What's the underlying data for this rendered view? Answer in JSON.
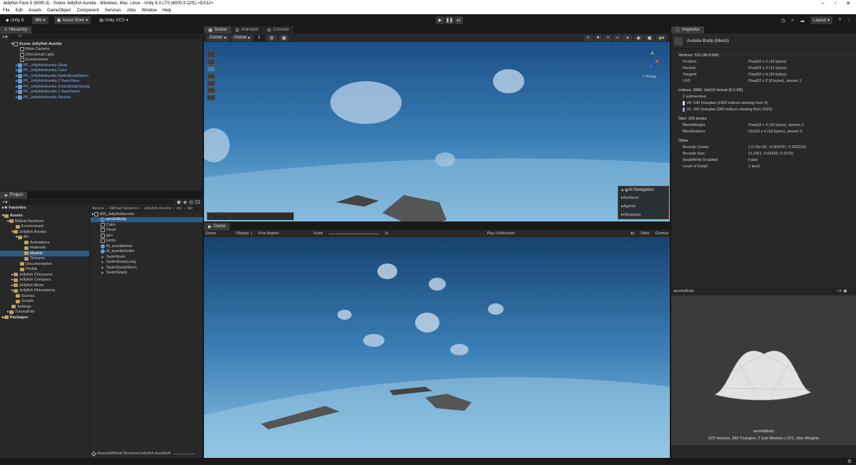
{
  "window": {
    "title": "Jellyfish Pack 5 (6000.3) - Scene Jellyfish Aurelia - Windows, Mac, Linux - Unity 6.3 LTS (6000.3.22f1) <DX12>"
  },
  "menu": [
    "File",
    "Edit",
    "Assets",
    "GameObject",
    "Component",
    "Services",
    "Jobs",
    "Window",
    "Help"
  ],
  "toolbar": {
    "unity": "Unity 6",
    "account": "MN",
    "store": "Asset Store",
    "vcs": "Unity VCS",
    "layout": "Layout"
  },
  "hierarchy": {
    "tab": "Hierarchy",
    "search_placeholder": "All",
    "scene": "Scene Jellyfish Aurelia",
    "items": [
      "Main Camera",
      "Directional Light",
      "Environment"
    ],
    "prefabs": [
      "PF_JellyfishAurelia Dead",
      "PF_JellyfishAurelia Calm",
      "PF_JellyfishAurelia SwimSlowlyNorm",
      "PF_JellyfishAurelia 2 SwimSlow",
      "PF_JellyfishAurelia SwimSlowlySlowly",
      "PF_JellyfishAurelia 1 SwimNorm",
      "PF_JellyfishAurelia Stracks"
    ]
  },
  "project": {
    "tab": "Project",
    "count": "21",
    "favorites": "Favorites",
    "assets": "Assets",
    "packages": "Packages",
    "tree": [
      "Mikhail Nesterov",
      "Environment",
      "Jellyfish Aurelia",
      "Art",
      "Animations",
      "Materials",
      "Models",
      "Textures",
      "Documentation",
      "Prefab",
      "Jellyfish Chrysaora",
      "Jellyfish Compass",
      "Jellyfish Moon",
      "Jellyfish Rhizostoma",
      "Scenes",
      "Scripts",
      "Settings",
      "TutorialInfo"
    ],
    "breadcrumb": [
      "Assets",
      "Mikhail Nesterov",
      "Jellyfish Aurelia",
      "Art",
      "Mo"
    ],
    "files": [
      "AM_JellyfishAurelia",
      "aureliaBody",
      "Calm",
      "Dead",
      "geo",
      "joints",
      "M_aureliaInner",
      "M_aureliaOutter",
      "SwimNorm",
      "SwimSlowlyLong",
      "SwimSlowlyNorm",
      "SwimSlowly"
    ],
    "footer": "Assets/Mikhail Nesterov/Jellyfish Aurelia/A"
  },
  "scene": {
    "tabs": [
      "Scene",
      "Animator",
      "Console"
    ],
    "pivot": "Center",
    "space": "Global",
    "snap": "1",
    "persp": "< Persp",
    "ai_nav": {
      "title": "AI Navigation",
      "items": [
        "Surfaces",
        "Agents",
        "Obstacles"
      ]
    }
  },
  "game": {
    "tab": "Game",
    "mode": "Game",
    "display": "Display 1",
    "aspect": "Free Aspect",
    "scale_label": "Scale",
    "scale_value": "1x",
    "play": "Play Unfocused",
    "stats": "Stats",
    "gizmos": "Gizmos"
  },
  "inspector": {
    "tab": "Inspector",
    "title": "Aurelia Body (Mesh)",
    "vertices": "Vertices: 523 (40.9 KB)",
    "attrs": [
      [
        "Position",
        "Float32 x 3 (12 bytes)"
      ],
      [
        "Normal",
        "Float32 x 3 (12 bytes)"
      ],
      [
        "Tangent",
        "Float32 x 4 (16 bytes)"
      ],
      [
        "UV0",
        "Float32 x 2 (8 bytes), stream 1"
      ]
    ],
    "indices": "Indices: 2880, Uint16 format (5.6 KB)",
    "submeshes": "2 submeshes:",
    "sub": [
      "#0: 640 triangles (1920 indices starting from 0)",
      "#1: 320 triangles (960 indices starting from 1920)"
    ],
    "skin": "Skin: 100 bones",
    "skin_attrs": [
      [
        "BlendWeight",
        "Float32 x 4 (16 bytes), stream 2"
      ],
      [
        "BlendIndices",
        "UInt32 x 4 (16 bytes), stream 2"
      ]
    ],
    "other": "Other",
    "other_attrs": [
      [
        "Bounds Center",
        "(-3.19e-05, -0.004787, 0.002216)"
      ],
      [
        "Bounds Size",
        "(0.1051, 0.04333, 0.1073)"
      ],
      [
        "Read/Write Enabled",
        "False"
      ],
      [
        "Level of Detail",
        "1 level"
      ]
    ],
    "preview_name": "aureliaBody",
    "preview_label": "aureliaBody",
    "preview_info": "523 Vertices, 960 Triangles, 2 Sub Meshes | UV1, Skin Weights"
  }
}
